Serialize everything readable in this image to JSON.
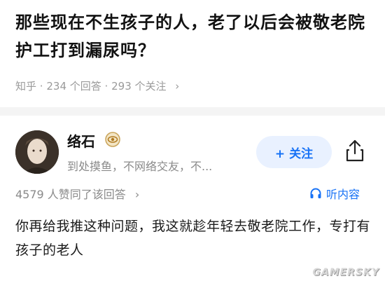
{
  "question": {
    "title": "那些现在不生孩子的人，老了以后会被敬老院护工打到漏尿吗？",
    "source": "知乎",
    "answer_count": "234 个回答",
    "follower_count": "293 个关注",
    "separator": "·"
  },
  "author": {
    "name": "络石",
    "bio": "到处摸鱼，不网络交友，不...",
    "follow_label": "+ 关注"
  },
  "answer": {
    "votes": "4579 人赞同了该回答",
    "listen_label": "听内容",
    "content": "你再给我推这种问题，我这就趁年轻去敬老院工作，专打有孩子的老人"
  },
  "watermark": "GAMERSKY",
  "colors": {
    "accent": "#1772f6",
    "follow_bg": "#e9f1ff",
    "meta": "#9a9a9a"
  },
  "icons": {
    "badge": "eye-badge-icon",
    "share": "share-icon",
    "listen": "headphones-icon",
    "chevron": "chevron-right-icon"
  }
}
